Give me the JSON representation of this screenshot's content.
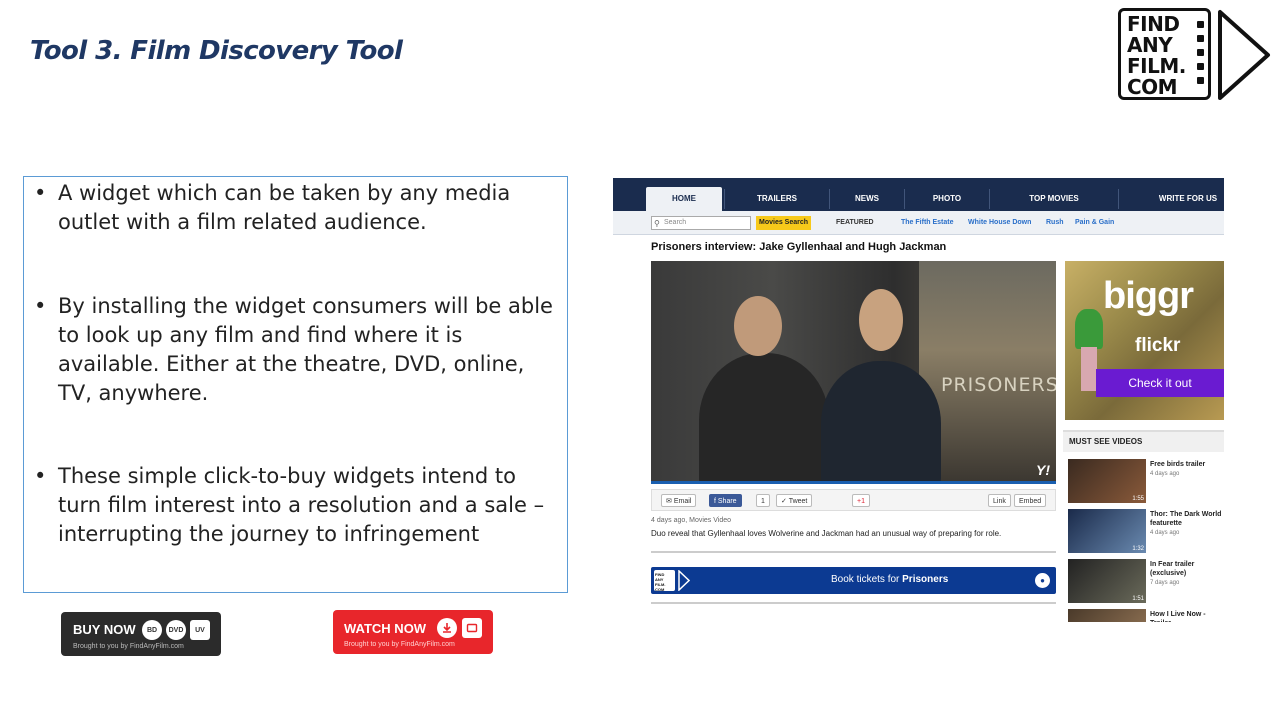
{
  "title": "Tool 3. Film Discovery Tool",
  "logo": {
    "lines": [
      "FIND",
      "ANY",
      "FILM.",
      "COM"
    ]
  },
  "bullets": [
    "A widget which can be taken by any media outlet with a film related audience.",
    "By installing the widget consumers will be able to look up any film and find where it is available. Either at the theatre, DVD, online, TV, anywhere.",
    "These simple click-to-buy widgets intend to turn film interest into a resolution and a sale – interrupting the journey to infringement"
  ],
  "buy_widget": {
    "label": "BUY NOW",
    "sub": "Brought to you by FindAnyFilm.com",
    "icons": [
      "bluray-icon",
      "dvd-icon",
      "lovefilm-icon"
    ],
    "icon_texts": [
      "BD",
      "DVD",
      "UV"
    ],
    "color": "#2b2b2b"
  },
  "watch_widget": {
    "label": "WATCH NOW",
    "sub": "Brought to you by FindAnyFilm.com",
    "icons": [
      "download-icon",
      "tv-icon"
    ],
    "color": "#e8262b"
  },
  "site": {
    "nav": [
      "HOME",
      "TRAILERS",
      "NEWS",
      "PHOTO",
      "TOP MOVIES",
      "WRITE FOR US"
    ],
    "search_placeholder": "Search",
    "movies_search": "Movies Search",
    "featured_label": "FEATURED",
    "featured_links": [
      "The Fifth Estate",
      "White House Down",
      "Rush",
      "Pain & Gain"
    ],
    "article_title": "Prisoners interview: Jake Gyllenhaal and Hugh Jackman",
    "poster_text": "PRISONERS",
    "video_badge": "Y!",
    "share": {
      "email": "Email",
      "share": "Share",
      "share_count": "1",
      "tweet": "Tweet",
      "plus": "+1",
      "link": "Link",
      "embed": "Embed"
    },
    "meta": "4 days ago, Movies Video",
    "description": "Duo reveal that Gyllenhaal loves Wolverine and Jackman had an unusual way of preparing for role.",
    "book": {
      "prefix": "Book tickets for ",
      "film": "Prisoners"
    },
    "ad": {
      "headline": "biggr",
      "brand": "flickr",
      "cta": "Check it out"
    },
    "must_see": {
      "header": "MUST SEE VIDEOS",
      "items": [
        {
          "title": "Free birds trailer",
          "date": "4 days ago",
          "duration": "1:55"
        },
        {
          "title": "Thor: The Dark World featurette",
          "date": "4 days ago",
          "duration": "1:32"
        },
        {
          "title": "In Fear trailer (exclusive)",
          "date": "7 days ago",
          "duration": "1:51"
        },
        {
          "title": "How I Live Now - Trailer",
          "date": "",
          "duration": ""
        }
      ]
    }
  },
  "colors": {
    "title": "#1f3864",
    "textbox_border": "#5b9bd5",
    "nav_bg": "#1a2c4e",
    "book_bar": "#0c3a92",
    "ad_cta": "#6a1bd1"
  }
}
